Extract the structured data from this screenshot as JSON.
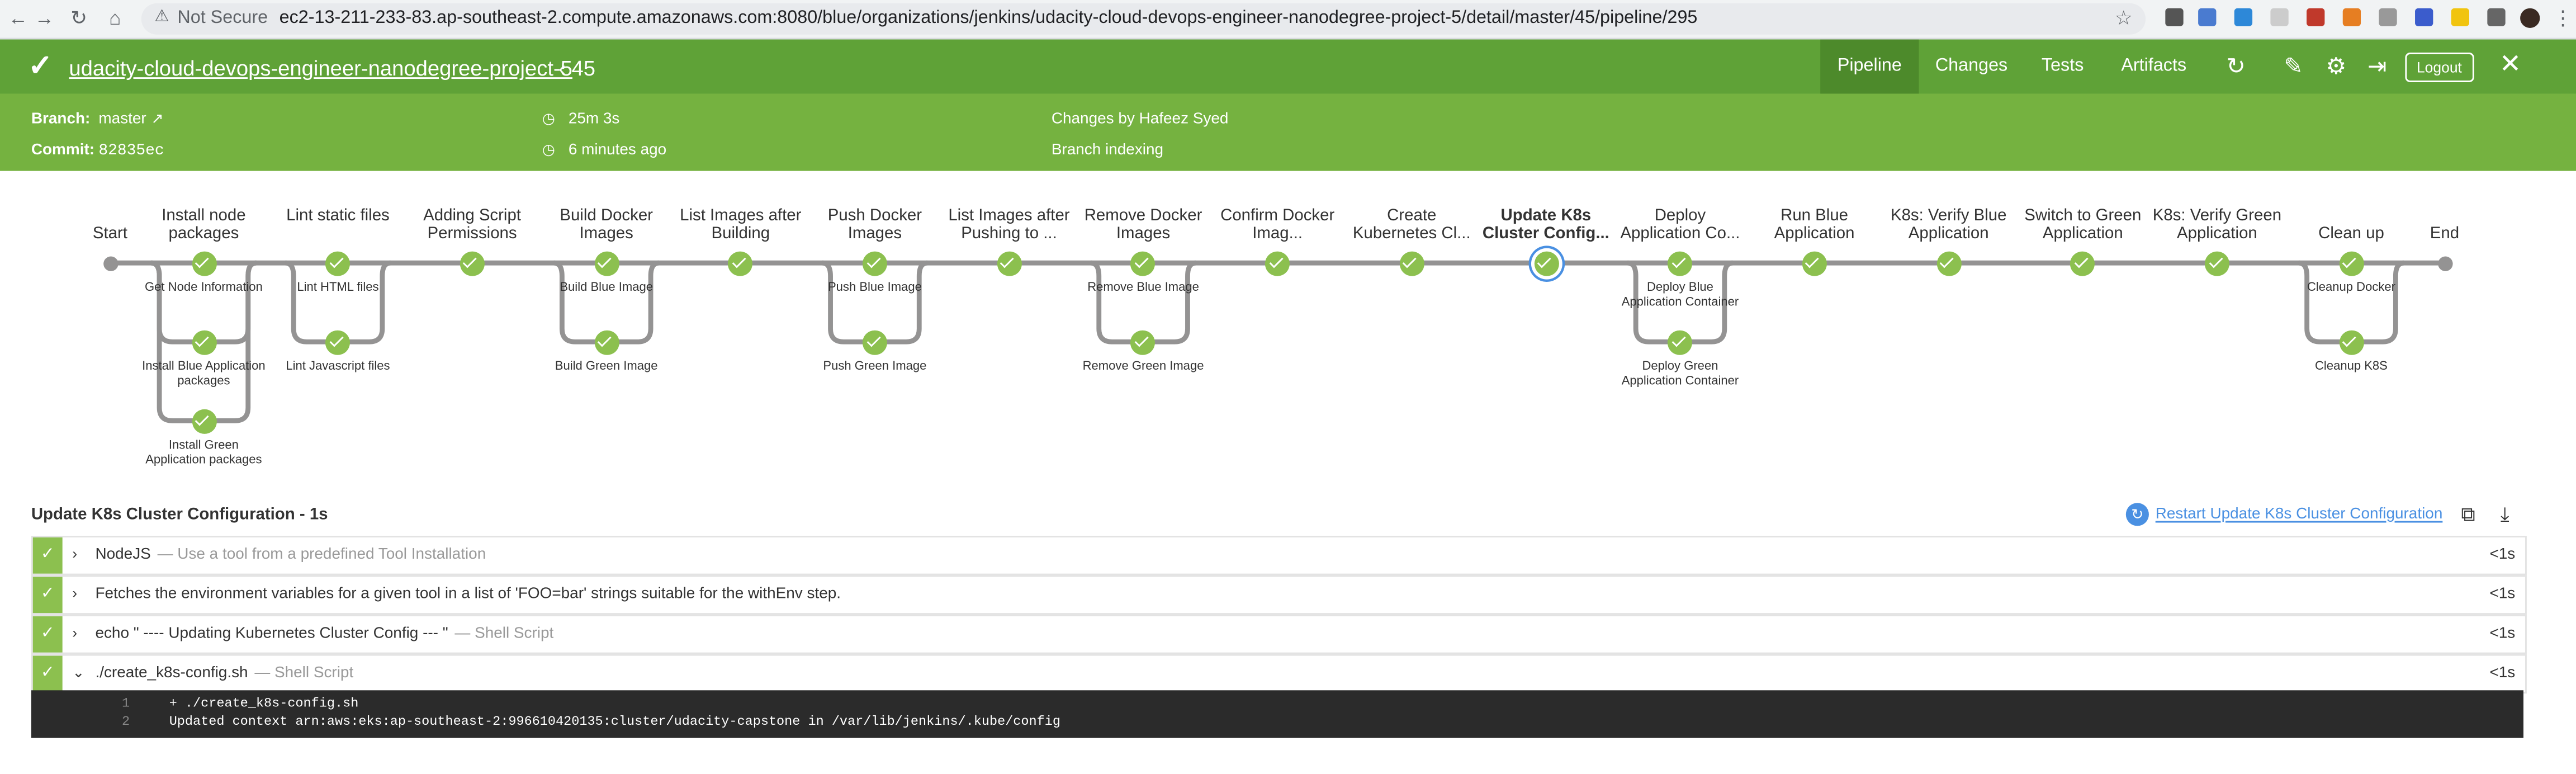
{
  "browser": {
    "security_label": "Not Secure",
    "url": "ec2-13-211-233-83.ap-southeast-2.compute.amazonaws.com:8080/blue/organizations/jenkins/udacity-cloud-devops-engineer-nanodegree-project-5/detail/master/45/pipeline/295"
  },
  "header": {
    "job_name": "udacity-cloud-devops-engineer-nanodegree-project-5",
    "run_number": "‹ 45",
    "tabs": [
      "Pipeline",
      "Changes",
      "Tests",
      "Artifacts"
    ],
    "active_tab": "Pipeline",
    "logout_label": "Logout",
    "accent_color": "#5fa237"
  },
  "meta": {
    "branch_label": "Branch:",
    "branch_value": "master",
    "commit_label": "Commit:",
    "commit_value": "82835ec",
    "duration": "25m 3s",
    "time_ago": "6 minutes ago",
    "changes_by": "Changes by Hafeez Syed",
    "cause": "Branch indexing"
  },
  "pipeline": {
    "start_label": "Start",
    "end_label": "End",
    "stages": [
      {
        "name": "Install node packages",
        "steps": [
          "Get Node Information",
          "Install Blue Application packages",
          "Install Green Application packages"
        ]
      },
      {
        "name": "Lint static files",
        "steps": [
          "Lint HTML files",
          "Lint Javascript files"
        ]
      },
      {
        "name": "Adding Script Permissions",
        "steps": []
      },
      {
        "name": "Build Docker Images",
        "steps": [
          "Build Blue Image",
          "Build Green Image"
        ]
      },
      {
        "name": "List Images after Building",
        "steps": []
      },
      {
        "name": "Push Docker Images",
        "steps": [
          "Push Blue Image",
          "Push Green Image"
        ]
      },
      {
        "name": "List Images after Pushing to ...",
        "steps": []
      },
      {
        "name": "Remove Docker Images",
        "steps": [
          "Remove Blue Image",
          "Remove Green Image"
        ]
      },
      {
        "name": "Confirm Docker Imag...",
        "steps": []
      },
      {
        "name": "Create Kubernetes Cl...",
        "steps": []
      },
      {
        "name": "Update K8s Cluster Config...",
        "steps": [],
        "selected": true
      },
      {
        "name": "Deploy Application Co...",
        "steps": [
          "Deploy Blue Application Container",
          "Deploy Green Application Container"
        ]
      },
      {
        "name": "Run Blue Application",
        "steps": []
      },
      {
        "name": "K8s: Verify Blue Application",
        "steps": []
      },
      {
        "name": "Switch to Green Application",
        "steps": []
      },
      {
        "name": "K8s: Verify Green Application",
        "steps": []
      },
      {
        "name": "Clean up",
        "steps": [
          "Cleanup Docker",
          "Cleanup K8S"
        ]
      }
    ]
  },
  "detail": {
    "title": "Update K8s Cluster Configuration - 1s",
    "restart_label": "Restart Update K8s Cluster Configuration",
    "steps": [
      {
        "name": "NodeJS",
        "desc": "— Use a tool from a predefined Tool Installation",
        "duration": "<1s",
        "expanded": false
      },
      {
        "name": "Fetches the environment variables for a given tool in a list of 'FOO=bar' strings suitable for the withEnv step.",
        "desc": "",
        "duration": "<1s",
        "expanded": false
      },
      {
        "name": "echo \" ---- Updating Kubernetes Cluster Config --- \"",
        "desc": "— Shell Script",
        "duration": "<1s",
        "expanded": false
      },
      {
        "name": "./create_k8s-config.sh",
        "desc": "— Shell Script",
        "duration": "<1s",
        "expanded": true
      }
    ],
    "log": [
      {
        "n": "1",
        "text": "+ ./create_k8s-config.sh"
      },
      {
        "n": "2",
        "text": "Updated context arn:aws:eks:ap-southeast-2:996610420135:cluster/udacity-capstone in /var/lib/jenkins/.kube/config"
      }
    ]
  }
}
